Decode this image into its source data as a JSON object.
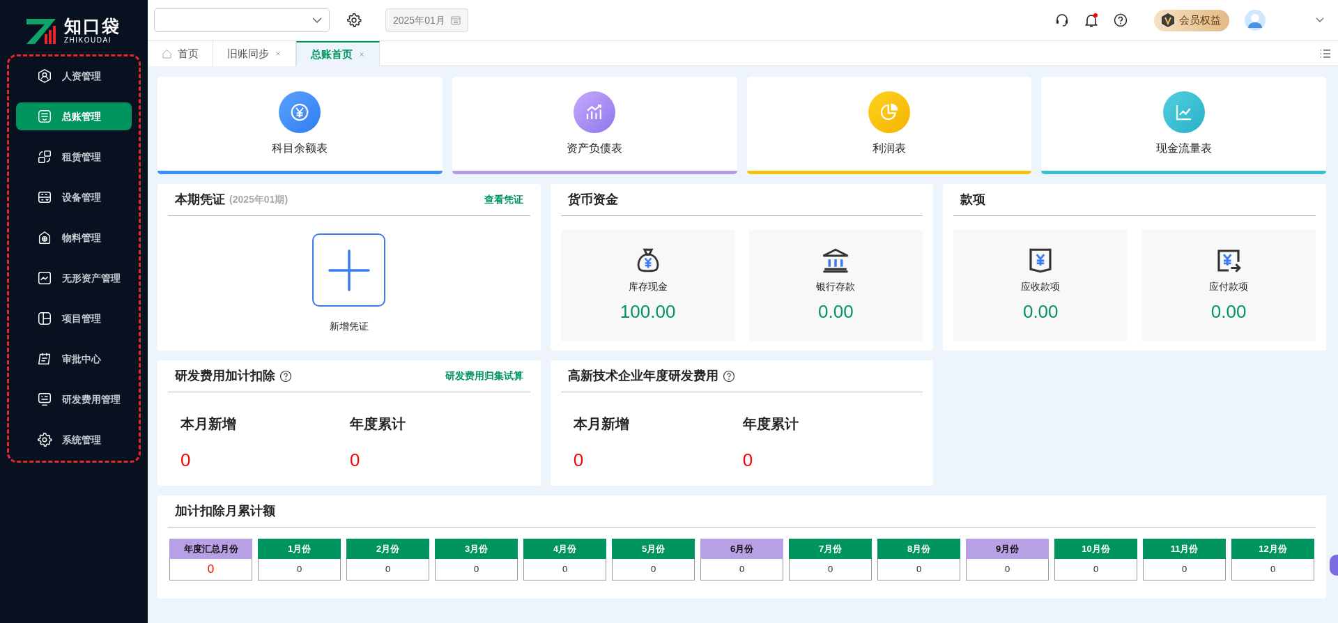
{
  "logo": {
    "name": "知口袋",
    "subtitle": "ZHIKOUDAI"
  },
  "sidebar": {
    "items": [
      {
        "label": "人资管理",
        "selected": false
      },
      {
        "label": "总账管理",
        "selected": true
      },
      {
        "label": "租赁管理",
        "selected": false
      },
      {
        "label": "设备管理",
        "selected": false
      },
      {
        "label": "物料管理",
        "selected": false
      },
      {
        "label": "无形资产管理",
        "selected": false
      },
      {
        "label": "项目管理",
        "selected": false
      },
      {
        "label": "审批中心",
        "selected": false
      },
      {
        "label": "研发费用管理",
        "selected": false
      },
      {
        "label": "系统管理",
        "selected": false
      }
    ]
  },
  "topbar": {
    "period": "2025年01月",
    "unread_notifications": true,
    "member_button": "会员权益"
  },
  "tabs": [
    {
      "label": "首页",
      "closable": false,
      "selected": false
    },
    {
      "label": "旧账同步",
      "closable": true,
      "selected": false
    },
    {
      "label": "总账首页",
      "closable": true,
      "selected": true
    }
  ],
  "report_cards": [
    {
      "label": "科目余额表",
      "color": "#3d8ef8"
    },
    {
      "label": "资产负债表",
      "color": "#b49cea"
    },
    {
      "label": "利润表",
      "color": "#f5c20f"
    },
    {
      "label": "现金流量表",
      "color": "#3bbdd2"
    }
  ],
  "voucher_panel": {
    "title": "本期凭证",
    "period": "(2025年01期)",
    "link": "查看凭证",
    "action": "新增凭证"
  },
  "cash_panel": {
    "title": "货币资金",
    "items": [
      {
        "label": "库存现金",
        "value": "100.00"
      },
      {
        "label": "银行存款",
        "value": "0.00"
      }
    ]
  },
  "payments_panel": {
    "title": "款项",
    "items": [
      {
        "label": "应收款项",
        "value": "0.00"
      },
      {
        "label": "应付款项",
        "value": "0.00"
      }
    ]
  },
  "rd_panel": {
    "title": "研发费用加计扣除",
    "link": "研发费用归集试算",
    "stats": [
      {
        "label": "本月新增",
        "value": "0"
      },
      {
        "label": "年度累计",
        "value": "0"
      }
    ]
  },
  "hightech_panel": {
    "title": "高新技术企业年度研发费用",
    "stats": [
      {
        "label": "本月新增",
        "value": "0"
      },
      {
        "label": "年度累计",
        "value": "0"
      }
    ]
  },
  "monthly": {
    "title": "加计扣除月累计额",
    "columns": [
      {
        "label": "年度汇总月份",
        "value": "0",
        "kind": "total",
        "color": "#b8a0e6"
      },
      {
        "label": "1月份",
        "value": "0",
        "kind": "month",
        "color": "#00945e"
      },
      {
        "label": "2月份",
        "value": "0",
        "kind": "month",
        "color": "#00945e"
      },
      {
        "label": "3月份",
        "value": "0",
        "kind": "month",
        "color": "#00945e"
      },
      {
        "label": "4月份",
        "value": "0",
        "kind": "month",
        "color": "#00945e"
      },
      {
        "label": "5月份",
        "value": "0",
        "kind": "month",
        "color": "#00945e"
      },
      {
        "label": "6月份",
        "value": "0",
        "kind": "month",
        "color": "#b8a0e6"
      },
      {
        "label": "7月份",
        "value": "0",
        "kind": "month",
        "color": "#00945e"
      },
      {
        "label": "8月份",
        "value": "0",
        "kind": "month",
        "color": "#00945e"
      },
      {
        "label": "9月份",
        "value": "0",
        "kind": "month",
        "color": "#b8a0e6"
      },
      {
        "label": "10月份",
        "value": "0",
        "kind": "month",
        "color": "#00945e"
      },
      {
        "label": "11月份",
        "value": "0",
        "kind": "month",
        "color": "#00945e"
      },
      {
        "label": "12月份",
        "value": "0",
        "kind": "month",
        "color": "#00945e"
      }
    ]
  }
}
